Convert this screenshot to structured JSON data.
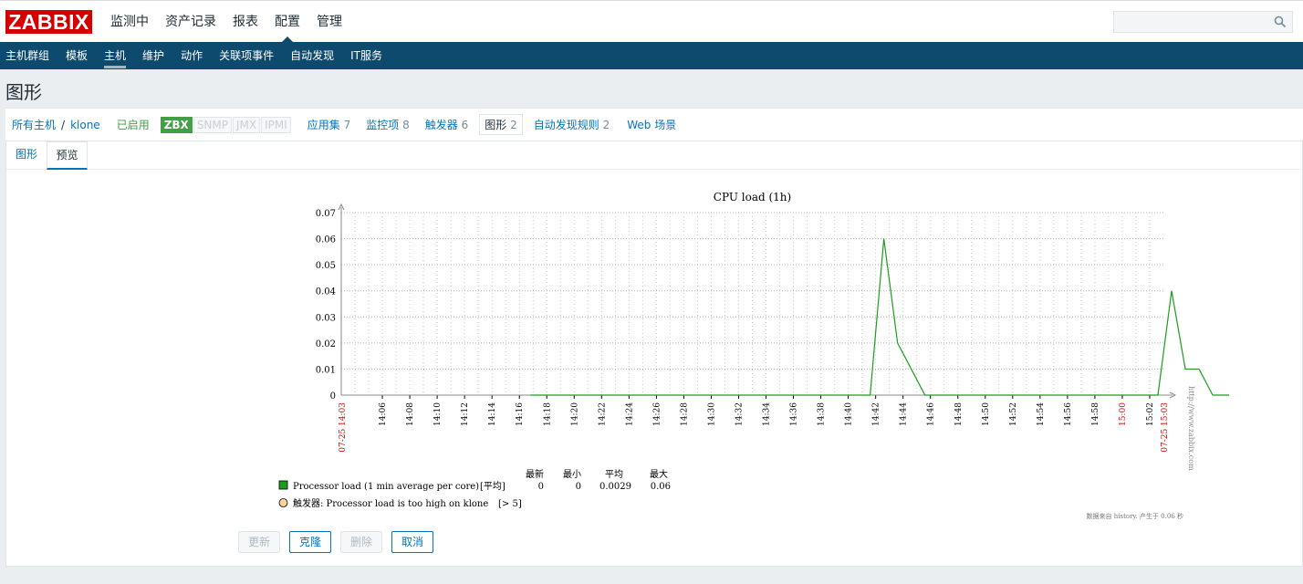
{
  "logo": "ZABBIX",
  "top_menu": [
    {
      "label": "监测中",
      "active": false
    },
    {
      "label": "资产记录",
      "active": false
    },
    {
      "label": "报表",
      "active": false
    },
    {
      "label": "配置",
      "active": true
    },
    {
      "label": "管理",
      "active": false
    }
  ],
  "search": {
    "placeholder": "",
    "value": ""
  },
  "sub_menu": [
    {
      "label": "主机群组",
      "active": false
    },
    {
      "label": "模板",
      "active": false
    },
    {
      "label": "主机",
      "active": true
    },
    {
      "label": "维护",
      "active": false
    },
    {
      "label": "动作",
      "active": false
    },
    {
      "label": "关联项事件",
      "active": false
    },
    {
      "label": "自动发现",
      "active": false
    },
    {
      "label": "IT服务",
      "active": false
    }
  ],
  "page_title": "图形",
  "breadcrumb": {
    "all_hosts": "所有主机",
    "separator": "/",
    "host": "klone",
    "status": "已启用",
    "interfaces": [
      {
        "label": "ZBX",
        "on": true
      },
      {
        "label": "SNMP",
        "on": false
      },
      {
        "label": "JMX",
        "on": false
      },
      {
        "label": "IPMI",
        "on": false
      }
    ],
    "tabs": [
      {
        "label": "应用集",
        "count": "7"
      },
      {
        "label": "监控项",
        "count": "8"
      },
      {
        "label": "触发器",
        "count": "6"
      },
      {
        "label": "图形",
        "count": "2",
        "selected": true
      },
      {
        "label": "自动发现规则",
        "count": "2"
      },
      {
        "label": "Web 场景",
        "count": ""
      }
    ]
  },
  "form_tabs": {
    "graph": "图形",
    "preview": "预览"
  },
  "chart_data": {
    "type": "line",
    "title": "CPU load (1h)",
    "ylim": [
      0,
      0.07
    ],
    "y_ticks": [
      "0.07",
      "0.06",
      "0.05",
      "0.04",
      "0.03",
      "0.02",
      "0.01",
      "0"
    ],
    "x_start_label": "07-25 14:03",
    "x_end_label": "07-25 15:03",
    "x_tick_labels": [
      "14:06",
      "14:08",
      "14:10",
      "14:12",
      "14:14",
      "14:16",
      "14:18",
      "14:20",
      "14:22",
      "14:24",
      "14:26",
      "14:28",
      "14:30",
      "14:32",
      "14:34",
      "14:36",
      "14:38",
      "14:40",
      "14:42",
      "14:44",
      "14:46",
      "14:48",
      "14:50",
      "14:52",
      "14:54",
      "14:56",
      "14:58",
      "15:00",
      "15:02"
    ],
    "x_tick_red": [
      "15:00"
    ],
    "series": [
      {
        "name": "Processor load (1 min average per core)",
        "color": "#1a9e1a",
        "x_minutes": [
          13.8,
          38.6,
          39.6,
          40.6,
          41.6,
          42.6,
          59.6,
          60.6,
          61.6,
          62.6,
          63.6,
          64.6,
          64.8
        ],
        "values": [
          0,
          0,
          0.06,
          0.02,
          0.01,
          0,
          0,
          0.04,
          0.01,
          0.01,
          0,
          0,
          0
        ]
      }
    ],
    "watermark": "http://www.zabbix.com",
    "footnote": "数据来自 history. 产生于 0.06 秒",
    "legend": {
      "headers": [
        "最新",
        "最小",
        "平均",
        "最大"
      ],
      "item": {
        "name": "Processor load (1 min average per core)",
        "func": "[平均]",
        "last": "0",
        "min": "0",
        "avg": "0.0029",
        "max": "0.06",
        "color": "#1a9e1a"
      },
      "trigger": {
        "label": "触发器: Processor load is too high on klone",
        "condition": "[> 5]",
        "color": "#f8d49a"
      }
    }
  },
  "buttons": [
    {
      "label": "更新",
      "disabled": true
    },
    {
      "label": "克隆",
      "disabled": false
    },
    {
      "label": "删除",
      "disabled": true
    },
    {
      "label": "取消",
      "disabled": false
    }
  ]
}
